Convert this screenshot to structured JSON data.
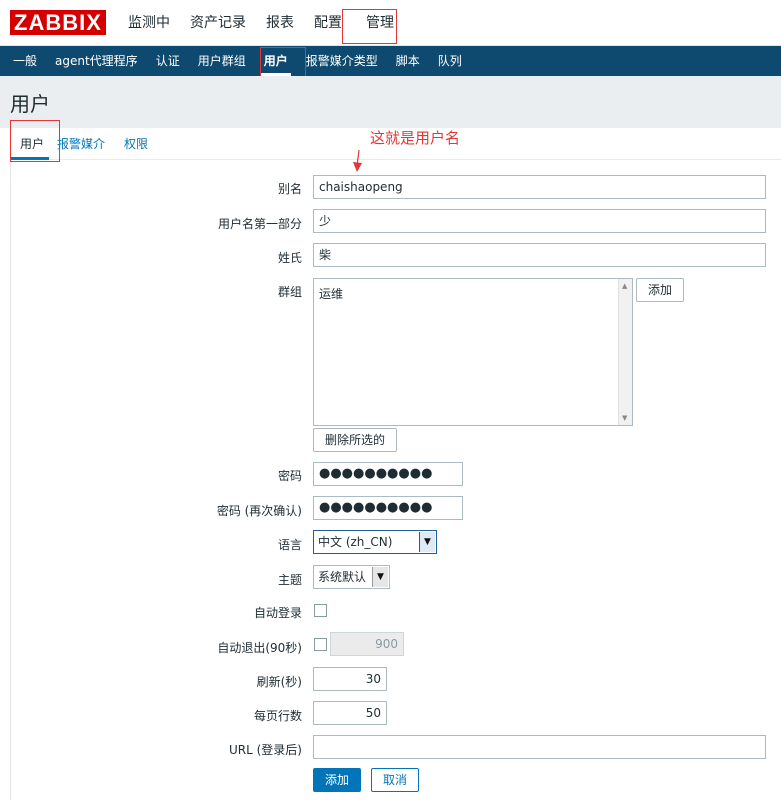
{
  "header": {
    "logo": "ZABBIX",
    "nav": [
      "监测中",
      "资产记录",
      "报表",
      "配置",
      "管理"
    ]
  },
  "subnav": [
    "一般",
    "agent代理程序",
    "认证",
    "用户群组",
    "用户",
    "报警媒介类型",
    "脚本",
    "队列"
  ],
  "page": {
    "title": "用户"
  },
  "tabs": [
    "用户",
    "报警媒介",
    "权限"
  ],
  "annotation": "这就是用户名",
  "form": {
    "alias_label": "别名",
    "alias_value": "chaishaopeng",
    "name_label": "用户名第一部分",
    "name_value": "少",
    "surname_label": "姓氏",
    "surname_value": "柴",
    "groups_label": "群组",
    "groups": [
      "运维"
    ],
    "add_button": "添加",
    "remove_selected_button": "删除所选的",
    "password_label": "密码",
    "password_value": "●●●●●●●●●●",
    "password2_label": "密码 (再次确认)",
    "password2_value": "●●●●●●●●●●",
    "language_label": "语言",
    "language_value": "中文 (zh_CN)",
    "theme_label": "主题",
    "theme_value": "系统默认",
    "autologin_label": "自动登录",
    "autologout_label": "自动退出(90秒)",
    "autologout_value": "900",
    "refresh_label": "刷新(秒)",
    "refresh_value": "30",
    "rows_label": "每页行数",
    "rows_value": "50",
    "url_label": "URL (登录后)",
    "url_value": "",
    "submit_button": "添加",
    "cancel_button": "取消"
  },
  "icons": {
    "select_caret": "caret-down-icon",
    "scroll_up": "scroll-up-icon",
    "scroll_down": "scroll-down-icon",
    "annotation_arrow": "arrow-down-icon"
  },
  "colors": {
    "brand": "#d40000",
    "subnav_bg": "#0e4a6f",
    "accent": "#0275b8",
    "annotation": "#e53535"
  }
}
